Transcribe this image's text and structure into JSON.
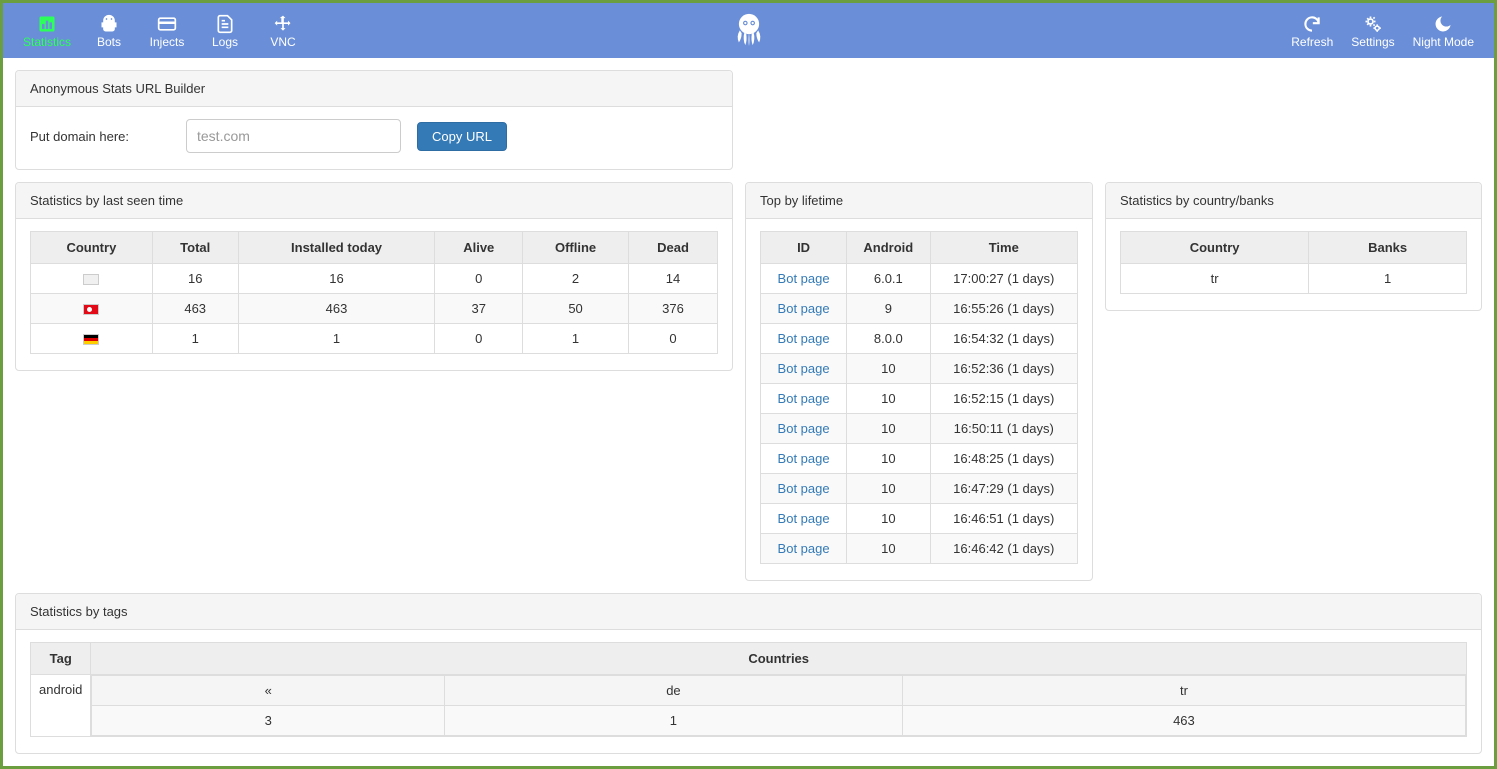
{
  "nav": {
    "left": [
      {
        "label": "Statistics",
        "icon": "chart-icon",
        "active": true
      },
      {
        "label": "Bots",
        "icon": "android-icon",
        "active": false
      },
      {
        "label": "Injects",
        "icon": "card-icon",
        "active": false
      },
      {
        "label": "Logs",
        "icon": "file-icon",
        "active": false
      },
      {
        "label": "VNC",
        "icon": "move-icon",
        "active": false
      }
    ],
    "right": [
      {
        "label": "Refresh",
        "icon": "refresh-icon"
      },
      {
        "label": "Settings",
        "icon": "gears-icon"
      },
      {
        "label": "Night Mode",
        "icon": "moon-icon"
      }
    ]
  },
  "url_builder": {
    "title": "Anonymous Stats URL Builder",
    "label": "Put domain here:",
    "placeholder": "test.com",
    "button": "Copy URL"
  },
  "stats_panel": {
    "title": "Statistics by last seen time",
    "headers": [
      "Country",
      "Total",
      "Installed today",
      "Alive",
      "Offline",
      "Dead"
    ],
    "rows": [
      {
        "flag": "unknown",
        "total": "16",
        "installed": "16",
        "alive": "0",
        "offline": "2",
        "dead": "14"
      },
      {
        "flag": "tr",
        "total": "463",
        "installed": "463",
        "alive": "37",
        "offline": "50",
        "dead": "376"
      },
      {
        "flag": "de",
        "total": "1",
        "installed": "1",
        "alive": "0",
        "offline": "1",
        "dead": "0"
      }
    ]
  },
  "top_panel": {
    "title": "Top by lifetime",
    "headers": [
      "ID",
      "Android",
      "Time"
    ],
    "link_text": "Bot page",
    "rows": [
      {
        "android": "6.0.1",
        "time": "17:00:27 (1 days)"
      },
      {
        "android": "9",
        "time": "16:55:26 (1 days)"
      },
      {
        "android": "8.0.0",
        "time": "16:54:32 (1 days)"
      },
      {
        "android": "10",
        "time": "16:52:36 (1 days)"
      },
      {
        "android": "10",
        "time": "16:52:15 (1 days)"
      },
      {
        "android": "10",
        "time": "16:50:11 (1 days)"
      },
      {
        "android": "10",
        "time": "16:48:25 (1 days)"
      },
      {
        "android": "10",
        "time": "16:47:29 (1 days)"
      },
      {
        "android": "10",
        "time": "16:46:51 (1 days)"
      },
      {
        "android": "10",
        "time": "16:46:42 (1 days)"
      }
    ]
  },
  "banks_panel": {
    "title": "Statistics by country/banks",
    "headers": [
      "Country",
      "Banks"
    ],
    "rows": [
      {
        "country": "tr",
        "banks": "1"
      }
    ]
  },
  "tags_panel": {
    "title": "Statistics by tags",
    "headers": [
      "Tag",
      "Countries"
    ],
    "tag": "android",
    "countries": [
      {
        "name": "«",
        "count": "3"
      },
      {
        "name": "de",
        "count": "1"
      },
      {
        "name": "tr",
        "count": "463"
      }
    ]
  }
}
